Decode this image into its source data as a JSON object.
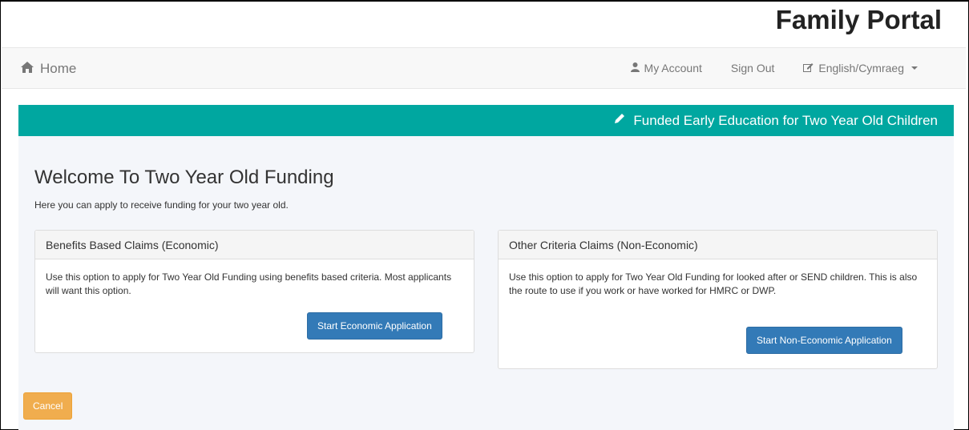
{
  "header": {
    "portal_title": "Family Portal"
  },
  "nav": {
    "home_label": "Home",
    "home_icon": "home-icon",
    "my_account_label": "My Account",
    "sign_out_label": "Sign Out",
    "language_label": "English/Cymraeg"
  },
  "banner": {
    "title": "Funded Early Education for Two Year Old Children",
    "color": "#00a7a0"
  },
  "main": {
    "title": "Welcome To Two Year Old Funding",
    "subtitle": "Here you can apply to receive funding for your two year old.",
    "panels": [
      {
        "heading": "Benefits Based Claims (Economic)",
        "body": "Use this option to apply for Two Year Old Funding using benefits based criteria. Most applicants will want this option.",
        "button_label": "Start Economic Application"
      },
      {
        "heading": "Other Criteria Claims (Non-Economic)",
        "body": "Use this option to apply for Two Year Old Funding for looked after or SEND children. This is also the route to use if you work or have worked for HMRC or DWP.",
        "button_label": "Start Non-Economic Application"
      }
    ],
    "cancel_label": "Cancel"
  },
  "colors": {
    "primary": "#337ab7",
    "warning": "#f0ad4e",
    "banner": "#00a7a0"
  }
}
